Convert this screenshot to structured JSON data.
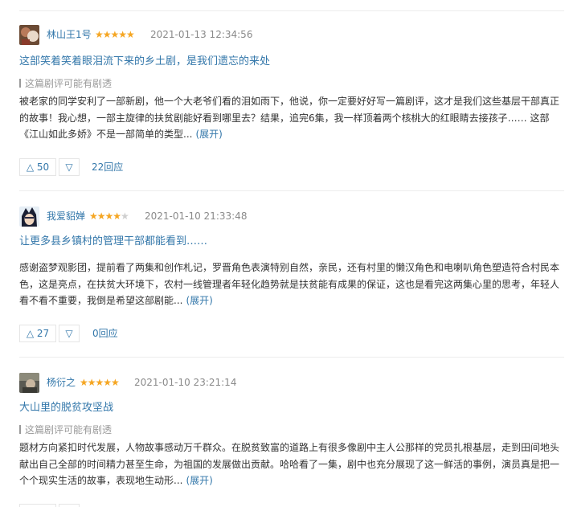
{
  "reviews": [
    {
      "author": "林山王1号",
      "stars": "★★★★★",
      "stars_dim": "",
      "rating": 5,
      "time": "2021-01-13 12:34:56",
      "title": "这部笑着笑着眼泪流下来的乡土剧，是我们遗忘的来处",
      "spoiler": "这篇剧评可能有剧透",
      "body": "被老家的同学安利了一部新剧，他一个大老爷们看的泪如雨下，他说，你一定要好好写一篇剧评，这才是我们这些基层干部真正的故事！我心想，一部主旋律的扶贫剧能好看到哪里去？结果，追完6集，我一样顶着两个核桃大的红眼睛去接孩子…… 这部《江山如此多娇》不是一部简单的类型...",
      "expand": "(展开)",
      "up_icon": "△",
      "up_count": "50",
      "down_icon": "▽",
      "reply": "22回应"
    },
    {
      "author": "我爱貂婵",
      "stars": "★★★★",
      "stars_dim": "★",
      "rating": 4,
      "time": "2021-01-10 21:33:48",
      "title": "让更多县乡镇村的管理干部都能看到……",
      "spoiler": "",
      "body": "感谢盗梦观影团，提前看了两集和创作札记，罗晋角色表演特别自然，亲民，还有村里的懒汉角色和电喇叭角色塑造符合村民本色，这是亮点，在扶贫大环境下，农村一线管理者年轻化趋势就是扶贫能有成果的保证，这也是看完这两集心里的思考，年轻人看不看不重要，我倒是希望这部剧能...",
      "expand": "(展开)",
      "up_icon": "△",
      "up_count": "27",
      "down_icon": "▽",
      "reply": "0回应"
    },
    {
      "author": "杨衍之",
      "stars": "★★★★★",
      "stars_dim": "",
      "rating": 5,
      "time": "2021-01-10 23:21:14",
      "title": "大山里的脱贫攻坚战",
      "spoiler": "这篇剧评可能有剧透",
      "body": "题材方向紧扣时代发展，人物故事感动万千群众。在脱贫致富的道路上有很多像剧中主人公那样的党员扎根基层，走到田间地头献出自己全部的时间精力甚至生命，为祖国的发展做出贡献。哈哈看了一集，剧中也充分展现了这一鲜活的事例，演员真是把一个个现实生活的故事，表现地生动形...",
      "expand": "(展开)"
    }
  ],
  "colors": {
    "link": "#3377aa",
    "star": "#f5a623",
    "meta": "#8a8a8a",
    "body": "#333333"
  }
}
